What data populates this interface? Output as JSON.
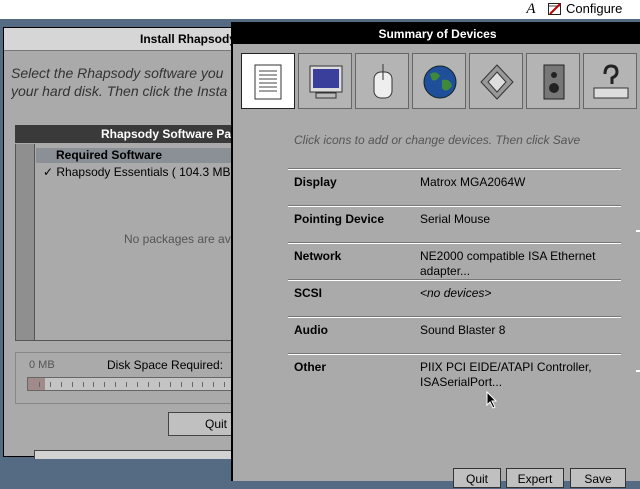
{
  "menubar": {
    "a_glyph": "A",
    "configure_label": "Configure",
    "configure_icon": "configure-icon"
  },
  "installer": {
    "title": "Install Rhapsody",
    "message": "Select the Rhapsody software you\nyour hard disk. Then click the Insta",
    "packages_header": "Rhapsody Software Pa",
    "required_header": "Required Software",
    "required_item": "✓ Rhapsody Essentials ( 104.3 MB)",
    "no_packages": "No packages are av",
    "disk_min": "0 MB",
    "disk_label": "Disk Space Required:",
    "disk_fill_fraction": 0.08,
    "quit_label": "Quit"
  },
  "summary": {
    "title": "Summary of Devices",
    "hint": "Click icons to add or change devices.  Then click Save",
    "toolbar": [
      {
        "icon": "summary-list-icon",
        "selected": true
      },
      {
        "icon": "display-monitor-icon",
        "selected": false
      },
      {
        "icon": "mouse-icon",
        "selected": false
      },
      {
        "icon": "network-globe-icon",
        "selected": false
      },
      {
        "icon": "scsi-icon",
        "selected": false
      },
      {
        "icon": "speaker-audio-icon",
        "selected": false
      },
      {
        "icon": "other-device-icon",
        "selected": false
      }
    ],
    "devices": [
      {
        "name": "Display",
        "value": "Matrox MGA2064W"
      },
      {
        "name": "Pointing Device",
        "value": "Serial Mouse"
      },
      {
        "name": "Network",
        "value": "NE2000 compatible ISA Ethernet adapter..."
      },
      {
        "name": "SCSI",
        "value": "<no devices>"
      },
      {
        "name": "Audio",
        "value": "Sound Blaster 8"
      },
      {
        "name": "Other",
        "value": "PIIX PCI EIDE/ATAPI Controller, ISASerialPort..."
      }
    ],
    "buttons": {
      "quit": "Quit",
      "expert": "Expert",
      "save": "Save"
    }
  },
  "colors": {
    "desktop": "#556a83",
    "window": "#aaaaaa",
    "titlebar": "#000000"
  }
}
